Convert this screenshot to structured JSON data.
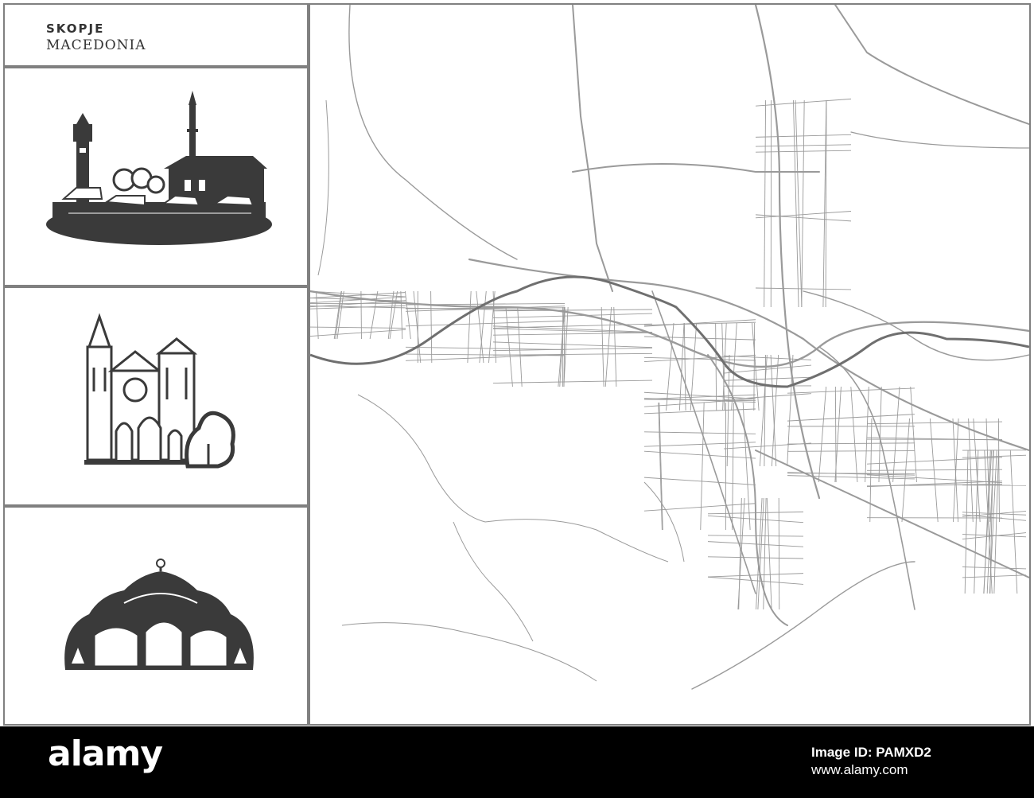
{
  "poster": {
    "city": "SKOPJE",
    "country": "MACEDONIA"
  },
  "landmarks": [
    {
      "icon": "old-bazaar-mosque-icon"
    },
    {
      "icon": "gothic-cathedral-icon"
    },
    {
      "icon": "domed-church-icon"
    }
  ],
  "map": {
    "style": "street-map",
    "road_color": "#9a9a9a",
    "river_color": "#6f6f6f"
  },
  "footer": {
    "brand": "alamy",
    "image_id": "Image ID: PAMXD2",
    "url": "www.alamy.com"
  }
}
